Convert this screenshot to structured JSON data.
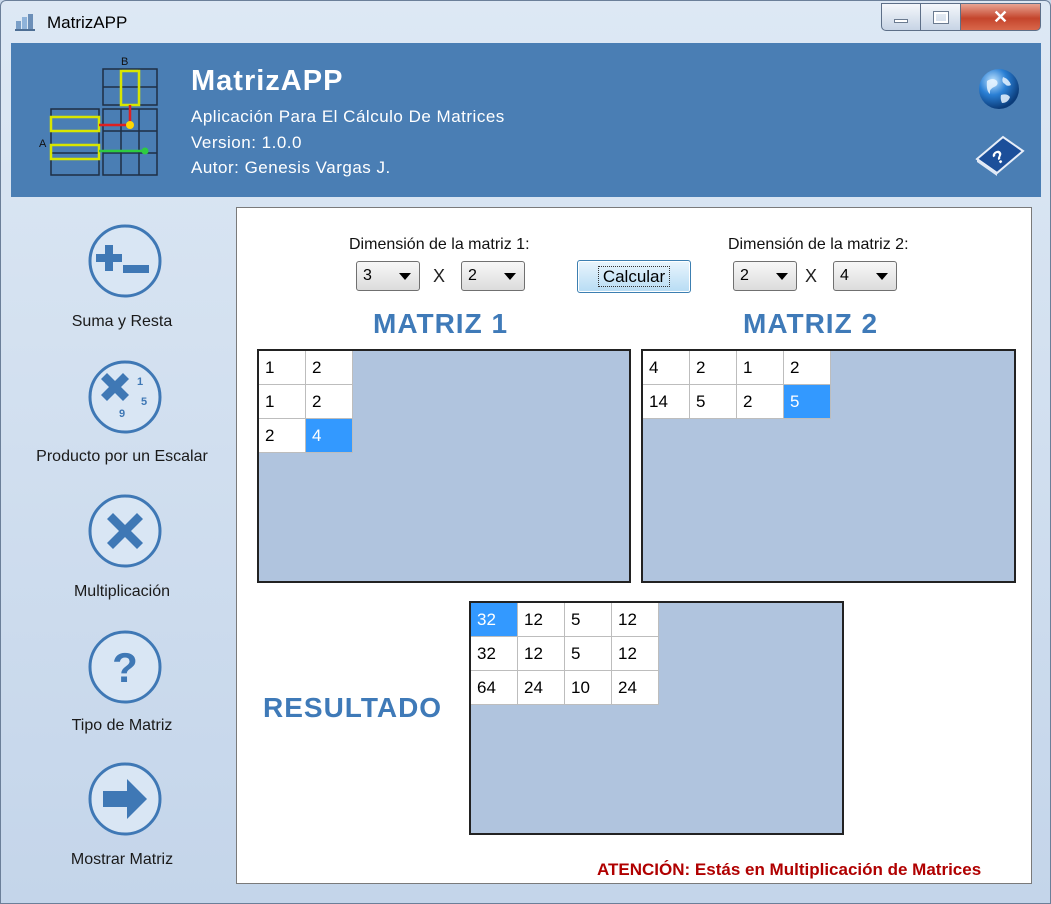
{
  "window": {
    "title": "MatrizAPP"
  },
  "header": {
    "app_name": "MatrizAPP",
    "subtitle": "Aplicación Para El Cálculo De Matrices",
    "version": "Version: 1.0.0",
    "author": "Autor: Genesis Vargas J.",
    "logo_labels": {
      "a": "A",
      "b": "B"
    }
  },
  "sidebar": {
    "items": [
      {
        "label": "Suma y Resta",
        "icon": "plus-minus-icon"
      },
      {
        "label": "Producto por un Escalar",
        "icon": "scalar-product-icon"
      },
      {
        "label": "Multiplicación",
        "icon": "multiply-icon"
      },
      {
        "label": "Tipo de Matriz",
        "icon": "question-icon"
      },
      {
        "label": "Mostrar Matriz",
        "icon": "arrow-right-icon"
      }
    ],
    "scalar_digits": [
      "1",
      "5",
      "9"
    ]
  },
  "controls": {
    "dim1_label": "Dimensión de la matriz 1:",
    "dim1_rows": "3",
    "dim1_cols": "2",
    "dim2_label": "Dimensión de la matriz 2:",
    "dim2_rows": "2",
    "dim2_cols": "4",
    "x_sep": "X",
    "calc_label": "Calcular"
  },
  "matrix1": {
    "title": "MATRIZ 1",
    "rows": [
      [
        "1",
        "2"
      ],
      [
        "1",
        "2"
      ],
      [
        "2",
        "4"
      ]
    ],
    "selected": [
      2,
      1
    ]
  },
  "matrix2": {
    "title": "MATRIZ 2",
    "rows": [
      [
        "4",
        "2",
        "1",
        "2"
      ],
      [
        "14",
        "5",
        "2",
        "5"
      ]
    ],
    "selected": [
      1,
      3
    ]
  },
  "result": {
    "title": "RESULTADO",
    "rows": [
      [
        "32",
        "12",
        "5",
        "12"
      ],
      [
        "32",
        "12",
        "5",
        "12"
      ],
      [
        "64",
        "24",
        "10",
        "24"
      ]
    ],
    "selected": [
      0,
      0
    ]
  },
  "status": {
    "prefix": "ATENCIÓN:",
    "text": " Estás en Multiplicación de Matrices"
  },
  "colors": {
    "header_bg": "#4a7eb4",
    "title_blue": "#3f7ab8",
    "grid_bg": "#b0c4de",
    "selection": "#3399ff",
    "warning": "#b00000"
  }
}
